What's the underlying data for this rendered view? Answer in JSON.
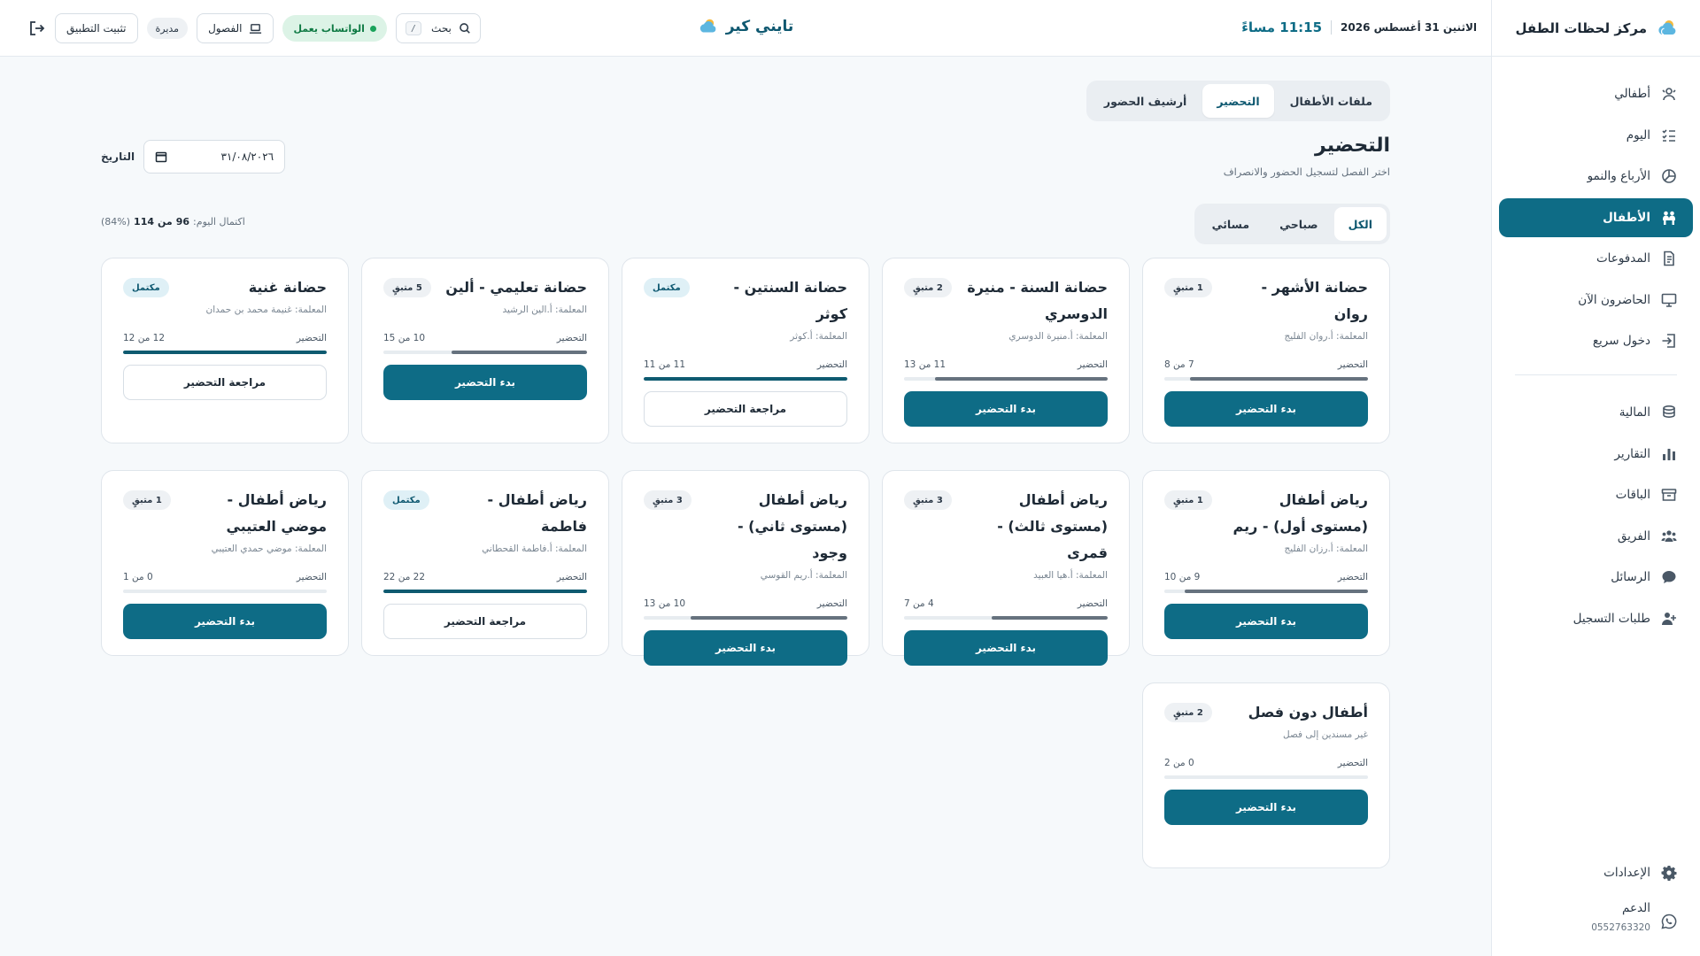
{
  "sidebar": {
    "brand": "مركز لحظات الطفل",
    "items": [
      {
        "label": "أطفالي",
        "icon": "kids-icon",
        "active": false
      },
      {
        "label": "اليوم",
        "icon": "checklist-icon",
        "active": false
      },
      {
        "label": "الأرباع والنمو",
        "icon": "growth-chart-icon",
        "active": false
      },
      {
        "label": "الأطفال",
        "icon": "children-icon",
        "active": true
      },
      {
        "label": "المدفوعات",
        "icon": "invoice-icon",
        "active": false
      },
      {
        "label": "الحاضرون الآن",
        "icon": "monitor-icon",
        "active": false
      },
      {
        "label": "دخول سريع",
        "icon": "login-icon",
        "active": false
      }
    ],
    "items2": [
      {
        "label": "المالية",
        "icon": "coins-icon"
      },
      {
        "label": "التقارير",
        "icon": "bar-chart-icon"
      },
      {
        "label": "الباقات",
        "icon": "package-icon"
      },
      {
        "label": "الفريق",
        "icon": "team-icon"
      },
      {
        "label": "الرسائل",
        "icon": "chat-icon"
      },
      {
        "label": "طلبات التسجيل",
        "icon": "user-plus-icon"
      }
    ],
    "settings": "الإعدادات",
    "support": "الدعم",
    "support_phone": "0552763320"
  },
  "topbar": {
    "date": "الاثنين 31 أغسطس 2026",
    "time": "11:15 مساءً",
    "app_name": "تايني كير",
    "search_label": "بحث",
    "search_shortcut": "/",
    "whatsapp_status": "الواتساب يعمل",
    "classes_label": "الفصول",
    "role": "مديرة",
    "install_label": "تثبيت التطبيق"
  },
  "tabs": [
    {
      "label": "ملفات الأطفال",
      "active": false
    },
    {
      "label": "التحضير",
      "active": true
    },
    {
      "label": "أرشيف الحضور",
      "active": false
    }
  ],
  "page": {
    "title": "التحضير",
    "subtitle": "اختر الفصل لتسجيل الحضور والانصراف",
    "date_label": "التاريخ",
    "date_value": "٣١/٠٨/٢٠٢٦"
  },
  "filters": [
    {
      "label": "الكل",
      "active": true
    },
    {
      "label": "صباحي",
      "active": false
    },
    {
      "label": "مسائي",
      "active": false
    }
  ],
  "completion": {
    "label": "اكتمال اليوم:",
    "present": "96",
    "of": "من",
    "total": "114",
    "percent": "(84%)"
  },
  "cards": [
    {
      "title": "حضانة الأشهر - روان",
      "teacher": "المعلمة: أ.روان الفليج",
      "badge": "1 متبقٍ",
      "status": "pending",
      "progress_label": "التحضير",
      "count": "7 من 8",
      "fraction": 0.875,
      "button": "بدء التحضير"
    },
    {
      "title": "حضانة السنة - منيرة الدوسري",
      "teacher": "المعلمة: أ.منيرة الدوسري",
      "badge": "2 متبقٍ",
      "status": "pending",
      "progress_label": "التحضير",
      "count": "11 من 13",
      "fraction": 0.846,
      "button": "بدء التحضير"
    },
    {
      "title": "حضانة السنتين - كوثر",
      "teacher": "المعلمة: أ.كوثر",
      "badge": "مكتمل",
      "status": "done",
      "progress_label": "التحضير",
      "count": "11 من 11",
      "fraction": 1,
      "button": "مراجعة التحضير"
    },
    {
      "title": "حضانة تعليمي - ألين",
      "teacher": "المعلمة: أ.الين الرشيد",
      "badge": "5 متبقٍ",
      "status": "pending",
      "progress_label": "التحضير",
      "count": "10 من 15",
      "fraction": 0.667,
      "button": "بدء التحضير"
    },
    {
      "title": "حضانة غنية",
      "teacher": "المعلمة: غنيمة محمد بن حمدان",
      "badge": "مكتمل",
      "status": "done",
      "progress_label": "التحضير",
      "count": "12 من 12",
      "fraction": 1,
      "button": "مراجعة التحضير"
    },
    {
      "title": "رياض أطفال (مستوى أول) - ريم",
      "teacher": "المعلمة: أ.رزان الفليج",
      "badge": "1 متبقٍ",
      "status": "pending",
      "progress_label": "التحضير",
      "count": "9 من 10",
      "fraction": 0.9,
      "button": "بدء التحضير"
    },
    {
      "title": "رياض أطفال (مستوى ثالث) - قمرى",
      "teacher": "المعلمة: أ.هيا العبيد",
      "badge": "3 متبقٍ",
      "status": "pending",
      "progress_label": "التحضير",
      "count": "4 من 7",
      "fraction": 0.571,
      "button": "بدء التحضير"
    },
    {
      "title": "رياض أطفال (مستوى ثاني) - وجود",
      "teacher": "المعلمة: أ.ريم القوسي",
      "badge": "3 متبقٍ",
      "status": "pending",
      "progress_label": "التحضير",
      "count": "10 من 13",
      "fraction": 0.769,
      "button": "بدء التحضير"
    },
    {
      "title": "رياض أطفال - فاطمة",
      "teacher": "المعلمة: أ.فاطمة القحطاني",
      "badge": "مكتمل",
      "status": "done",
      "progress_label": "التحضير",
      "count": "22 من 22",
      "fraction": 1,
      "button": "مراجعة التحضير"
    },
    {
      "title": "رياض أطفال - موضي العتيبي",
      "teacher": "المعلمة: موضي حمدي العتيبي",
      "badge": "1 متبقٍ",
      "status": "pending",
      "progress_label": "التحضير",
      "count": "0 من 1",
      "fraction": 0,
      "button": "بدء التحضير"
    },
    {
      "title": "أطفال دون فصل",
      "teacher": "غير مسندين إلى فصل",
      "badge": "2 متبقٍ",
      "status": "pending",
      "progress_label": "التحضير",
      "count": "0 من 2",
      "fraction": 0,
      "button": "بدء التحضير"
    }
  ],
  "colors": {
    "accent": "#0e6c86",
    "accent_dark": "#0e5870",
    "bg": "#f6f9fb",
    "success": "#1aa35b"
  }
}
